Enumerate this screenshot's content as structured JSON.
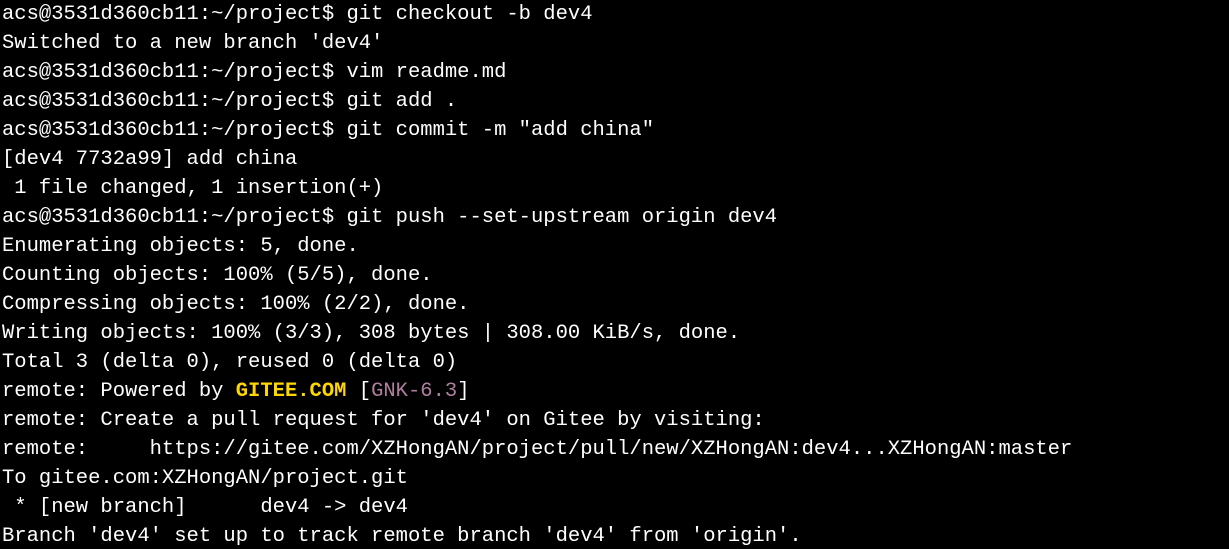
{
  "prompt": "acs@3531d360cb11:~/project$",
  "colors": {
    "background": "#000000",
    "text": "#ffffff",
    "gitee": "#ffd700",
    "gnk": "#b07fa0"
  },
  "lines": {
    "l1_cmd": " git checkout -b dev4",
    "l2": "Switched to a new branch 'dev4'",
    "l3_cmd": " vim readme.md",
    "l4_cmd": " git add .",
    "l5_cmd": " git commit -m \"add china\"",
    "l6": "[dev4 7732a99] add china",
    "l7": " 1 file changed, 1 insertion(+)",
    "l8_cmd": " git push --set-upstream origin dev4",
    "l9": "Enumerating objects: 5, done.",
    "l10": "Counting objects: 100% (5/5), done.",
    "l11": "Compressing objects: 100% (2/2), done.",
    "l12": "Writing objects: 100% (3/3), 308 bytes | 308.00 KiB/s, done.",
    "l13": "Total 3 (delta 0), reused 0 (delta 0)",
    "l14_pre": "remote: Powered by ",
    "l14_gitee": "GITEE.COM",
    "l14_mid": " [",
    "l14_gnk": "GNK-6.3",
    "l14_post": "]",
    "l15": "remote: Create a pull request for 'dev4' on Gitee by visiting:",
    "l16": "remote:     https://gitee.com/XZHongAN/project/pull/new/XZHongAN:dev4...XZHongAN:master",
    "l17": "To gitee.com:XZHongAN/project.git",
    "l18": " * [new branch]      dev4 -> dev4",
    "l19": "Branch 'dev4' set up to track remote branch 'dev4' from 'origin'."
  }
}
